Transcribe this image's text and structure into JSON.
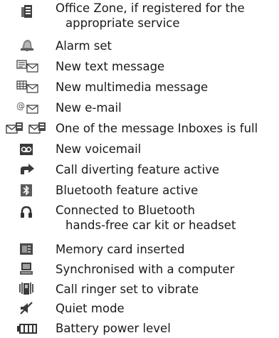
{
  "items": [
    {
      "icon": "office-zone-icon",
      "line1": "Office Zone, if registered for the",
      "line2": "appropriate service"
    },
    {
      "icon": "alarm-bell-icon",
      "line1": "Alarm set"
    },
    {
      "icon": "text-message-icon",
      "line1": "New text message"
    },
    {
      "icon": "multimedia-message-icon",
      "line1": "New multimedia message"
    },
    {
      "icon": "email-icon",
      "line1": "New e-mail"
    },
    {
      "icon": "inbox-full-icon",
      "line1": "One of the message Inboxes is full"
    },
    {
      "icon": "voicemail-icon",
      "line1": "New voicemail"
    },
    {
      "icon": "call-divert-icon",
      "line1": "Call diverting feature active"
    },
    {
      "icon": "bluetooth-icon",
      "line1": "Bluetooth feature active"
    },
    {
      "icon": "headset-icon",
      "line1": "Connected to Bluetooth",
      "line2": "hands-free car kit or headset"
    },
    {
      "icon": "memory-card-icon",
      "line1": "Memory card inserted"
    },
    {
      "icon": "computer-sync-icon",
      "line1": "Synchronised with a computer"
    },
    {
      "icon": "vibrate-icon",
      "line1": "Call ringer set to vibrate"
    },
    {
      "icon": "quiet-mode-icon",
      "line1": "Quiet mode"
    },
    {
      "icon": "battery-icon",
      "line1": "Battery power level"
    }
  ]
}
